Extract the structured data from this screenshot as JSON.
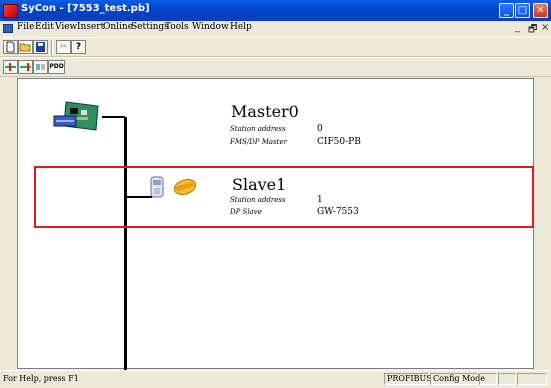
{
  "window": {
    "title": "SyCon - [7553_test.pb]",
    "min_glyph": "_",
    "max_glyph": "□",
    "close_glyph": "✕"
  },
  "menubar": {
    "items": [
      "File",
      "Edit",
      "View",
      "Insert",
      "Online",
      "Settings",
      "Tools",
      "Window",
      "Help"
    ],
    "mdi_min": "_",
    "mdi_restore": "🗗",
    "mdi_close": "×"
  },
  "toolbar": {
    "new_icon": "new-document-icon",
    "open_icon": "open-folder-icon",
    "save_icon": "save-disk-icon",
    "cut_icon": "cut-icon",
    "help_icon": "help-question-icon",
    "help_glyph": "?",
    "cut_glyph": "✂",
    "pdd_label": "PDD"
  },
  "devices": {
    "master": {
      "name": "Master0",
      "address_label": "Station address",
      "address_value": "0",
      "type_label": "FMS/DP Master",
      "type_value": "CIF50-PB"
    },
    "slave": {
      "name": "Slave1",
      "address_label": "Station address",
      "address_value": "1",
      "type_label": "DP Slave",
      "type_value": "GW-7553"
    }
  },
  "statusbar": {
    "message": "For Help, press F1",
    "bus": "PROFIBUS",
    "mode": "Config Mode"
  },
  "colors": {
    "highlight": "#e01a1a",
    "titlebar": "#0a5ee8"
  }
}
